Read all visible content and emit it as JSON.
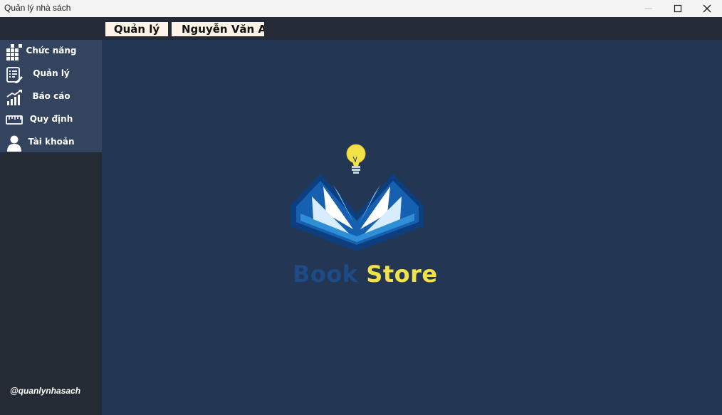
{
  "window": {
    "title": "Quản lý nhà sách"
  },
  "header": {
    "role": "Quản lý",
    "user": "Nguyễn Văn A"
  },
  "sidebar": {
    "items": [
      {
        "label": "Chức năng",
        "icon": "grid-icon"
      },
      {
        "label": "Quản lý",
        "icon": "list-edit-icon"
      },
      {
        "label": "Báo cáo",
        "icon": "chart-icon"
      },
      {
        "label": "Quy định",
        "icon": "ruler-icon"
      },
      {
        "label": "Tài khoản",
        "icon": "user-icon"
      }
    ],
    "footer": "@quanlynhasach"
  },
  "brand": {
    "word1": "Book",
    "word2": "Store"
  },
  "colors": {
    "sidebar": "#252b35",
    "menu": "#34445e",
    "main": "#233654",
    "brand_blue": "#1e4a86",
    "brand_yellow": "#f3e14a"
  }
}
